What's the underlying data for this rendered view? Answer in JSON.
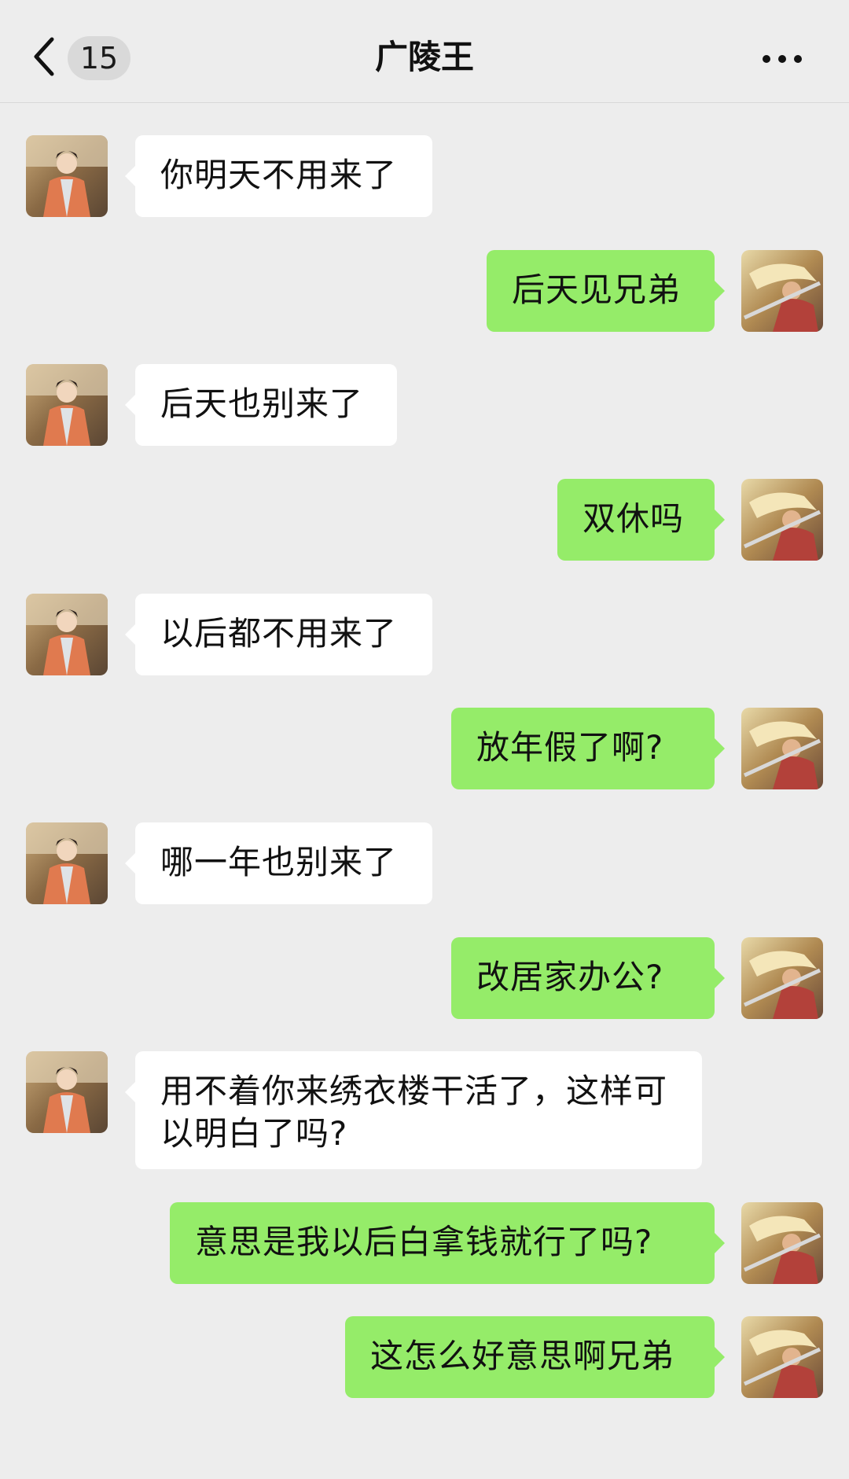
{
  "header": {
    "back_icon": "chevron-left-icon",
    "unread_count": "15",
    "title": "广陵王",
    "more_icon": "more-dots-icon"
  },
  "colors": {
    "background": "#ededed",
    "self_bubble": "#95ec69",
    "other_bubble": "#ffffff"
  },
  "messages": [
    {
      "sender": "other",
      "text": "你明天不用来了"
    },
    {
      "sender": "self",
      "text": "后天见兄弟"
    },
    {
      "sender": "other",
      "text": "后天也别来了"
    },
    {
      "sender": "self",
      "text": "双休吗"
    },
    {
      "sender": "other",
      "text": "以后都不用来了"
    },
    {
      "sender": "self",
      "text": "放年假了啊?"
    },
    {
      "sender": "other",
      "text": "哪一年也别来了"
    },
    {
      "sender": "self",
      "text": "改居家办公?"
    },
    {
      "sender": "other",
      "text": "用不着你来绣衣楼干活了，这样可以明白了吗?"
    },
    {
      "sender": "self",
      "text": "意思是我以后白拿钱就行了吗?"
    },
    {
      "sender": "self",
      "text": "这怎么好意思啊兄弟"
    }
  ]
}
